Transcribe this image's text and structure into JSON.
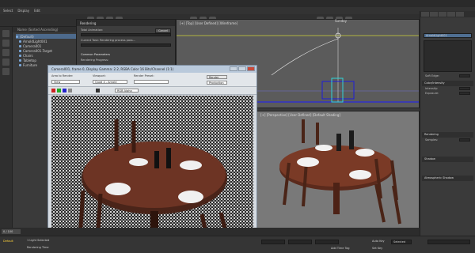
{
  "menu": [
    "Select",
    "Display",
    "Edit"
  ],
  "explorer": {
    "tabs": [
      "Select",
      "Display",
      "Edit"
    ],
    "column_header": "Name (Sorted Ascending)",
    "tree": [
      {
        "label": "(Default)",
        "selected": true
      },
      {
        "label": "ArnoldLight001",
        "selected": false
      },
      {
        "label": "Camera001",
        "selected": false
      },
      {
        "label": "Camera001.Target",
        "selected": false
      },
      {
        "label": "Chairs",
        "selected": false
      },
      {
        "label": "Tabletop",
        "selected": false
      },
      {
        "label": "Furniture",
        "selected": false
      }
    ],
    "layer": "Default"
  },
  "render_dialog": {
    "title": "Rendering",
    "total_animation": "Total Animation:",
    "pause_button": "Cancel",
    "current_task": "Current Task:  Rendering process pass...",
    "common_params": "Common Parameters",
    "rendering_progress": "Rendering Progress:"
  },
  "viewports": {
    "top_label": "[+] [Top] [User Defined] [Wireframe]",
    "persp_label": "[+] [Perspective] [User Defined] [Default Shading]",
    "top_center_label": "Sunday"
  },
  "frame_buffer": {
    "title": "Camera001, frame 0, Display Gamma: 2.2, RGBA Color 16 Bits/Channel (1:1)",
    "area_label": "Area to Render:",
    "area_value": "View",
    "viewport_label": "Viewport:",
    "viewport_value": "Quad 4 - Arnold",
    "preset_label": "Render Preset:",
    "preset_value": "",
    "render_button": "Render",
    "production_value": "Production",
    "channel_value": "RGB Alpha"
  },
  "command_panel": {
    "object_name": "ArnoldLight001",
    "rollouts": [
      "Color/Intensity",
      "Rendering",
      "Shadow",
      "Atmospheric Shadow"
    ],
    "props": [
      {
        "label": "Soft Edge:",
        "value": "1.0"
      },
      {
        "label": "Intensity:",
        "value": "1.0"
      },
      {
        "label": "Exposure:",
        "value": "0.0"
      },
      {
        "label": "Samples:",
        "value": "1"
      }
    ]
  },
  "status": {
    "frame_counter": "0 / 100",
    "selection": "1 Light Selected",
    "prompt": "Rendering Time",
    "auto_key": "Auto Key",
    "set_key": "Set Key",
    "selected": "Selected",
    "add_time_tag": "Add Time Tag"
  }
}
